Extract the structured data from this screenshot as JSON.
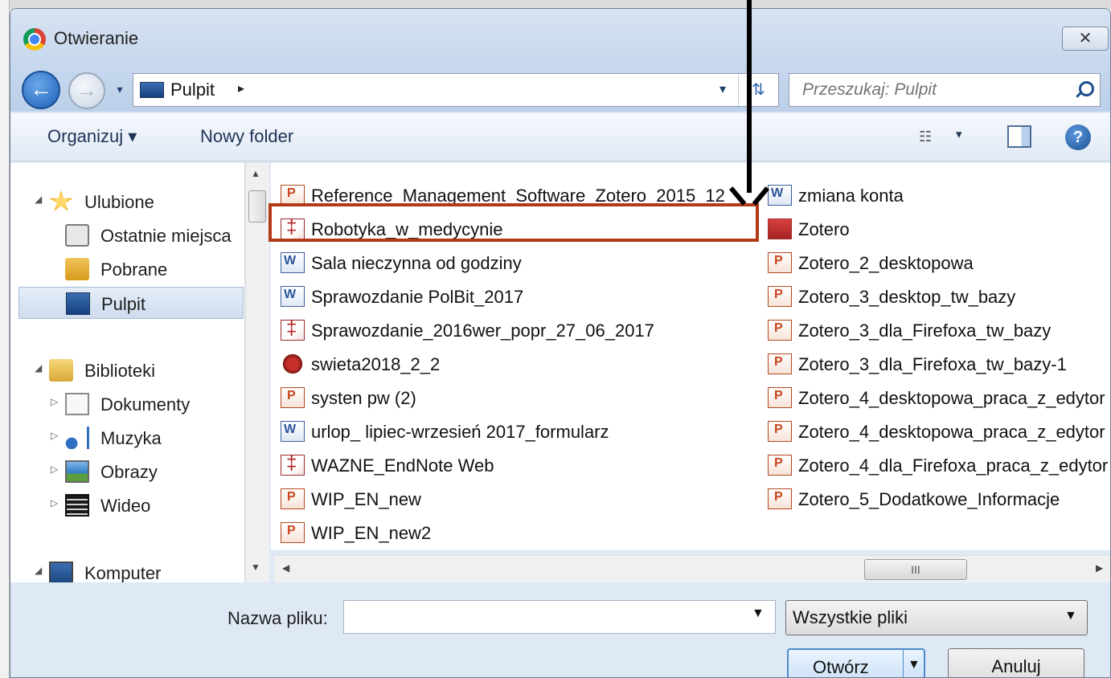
{
  "window": {
    "title": "Otwieranie",
    "close_glyph": "✕",
    "icon": "chrome-icon"
  },
  "nav": {
    "back_glyph": "←",
    "forward_glyph": "→",
    "history_glyph": "▾",
    "address": "Pulpit",
    "address_sep": "▸",
    "address_drop": "▾",
    "refresh_glyph": "⇅",
    "search_placeholder": "Przeszukaj: Pulpit"
  },
  "toolbar": {
    "organize": "Organizuj ▾",
    "new_folder": "Nowy folder",
    "view_glyph": "☷",
    "view_drop": "▾",
    "help_glyph": "?"
  },
  "sidebar": {
    "favorites": {
      "label": "Ulubione",
      "arrow": "◢"
    },
    "recent": "Ostatnie miejsca",
    "downloads": "Pobrane",
    "desktop": "Pulpit",
    "libraries": {
      "label": "Biblioteki",
      "arrow": "◢"
    },
    "documents": {
      "label": "Dokumenty",
      "arrow": "▷"
    },
    "music": {
      "label": "Muzyka",
      "arrow": "▷"
    },
    "pictures": {
      "label": "Obrazy",
      "arrow": "▷"
    },
    "video": {
      "label": "Wideo",
      "arrow": "▷"
    },
    "computer": {
      "label": "Komputer",
      "arrow": "◢"
    }
  },
  "scroll": {
    "up": "▲",
    "down": "▼",
    "left": "◀",
    "right": "▶",
    "grip": "III"
  },
  "files": {
    "col1": [
      {
        "name": "Reference_Management_Software_Zotero_2015_12",
        "type": "ppt"
      },
      {
        "name": "Robotyka_w_medycynie",
        "type": "pdf"
      },
      {
        "name": "Sala nieczynna od godziny",
        "type": "word"
      },
      {
        "name": "Sprawozdanie PolBit_2017",
        "type": "word"
      },
      {
        "name": "Sprawozdanie_2016wer_popr_27_06_2017",
        "type": "pdf"
      },
      {
        "name": "swieta2018_2_2",
        "type": "img"
      },
      {
        "name": "systen pw (2)",
        "type": "ppt"
      },
      {
        "name": "urlop_ lipiec-wrzesień 2017_formularz",
        "type": "word"
      },
      {
        "name": "WAZNE_EndNote Web",
        "type": "pdf"
      },
      {
        "name": "WIP_EN_new",
        "type": "ppt"
      },
      {
        "name": "WIP_EN_new2",
        "type": "ppt"
      }
    ],
    "col2": [
      {
        "name": "zmiana konta",
        "type": "word"
      },
      {
        "name": "Zotero",
        "type": "shortcut"
      },
      {
        "name": "Zotero_2_desktopowa",
        "type": "ppt"
      },
      {
        "name": "Zotero_3_desktop_tw_bazy",
        "type": "ppt"
      },
      {
        "name": "Zotero_3_dla_Firefoxa_tw_bazy",
        "type": "ppt"
      },
      {
        "name": "Zotero_3_dla_Firefoxa_tw_bazy-1",
        "type": "ppt"
      },
      {
        "name": "Zotero_4_desktopowa_praca_z_edytor",
        "type": "ppt"
      },
      {
        "name": "Zotero_4_desktopowa_praca_z_edytor",
        "type": "ppt"
      },
      {
        "name": "Zotero_4_dla_Firefoxa_praca_z_edytor",
        "type": "ppt"
      },
      {
        "name": "Zotero_5_Dodatkowe_Informacje",
        "type": "ppt"
      }
    ]
  },
  "bottom": {
    "filename_label": "Nazwa pliku:",
    "filename_value": "",
    "filename_drop": "▼",
    "filetype": "Wszystkie pliki",
    "filetype_drop": "▼",
    "open": "Otwórz",
    "open_drop": "▼",
    "cancel": "Anuluj"
  },
  "colors": {
    "highlight": "#b33a17",
    "pointer": "#000000",
    "accent": "#4c8bc9"
  }
}
